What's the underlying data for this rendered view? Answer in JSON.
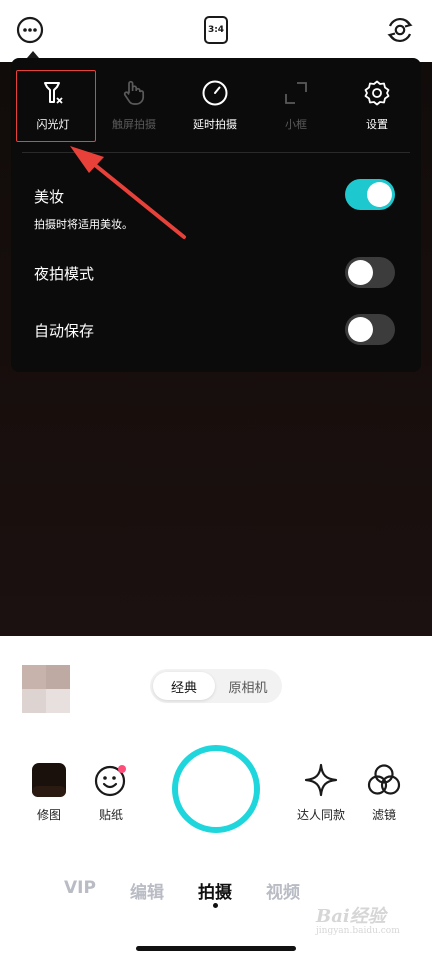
{
  "top_bar": {
    "more_icon": "more-dots-icon",
    "aspect_ratio_label": "3:4",
    "flip_icon": "camera-flip-icon"
  },
  "settings_panel": {
    "tools": [
      {
        "label": "闪光灯",
        "icon": "flash-off-icon",
        "enabled": true
      },
      {
        "label": "触屏拍摄",
        "icon": "touch-hand-icon",
        "enabled": false
      },
      {
        "label": "延时拍摄",
        "icon": "timer-icon",
        "enabled": true
      },
      {
        "label": "小框",
        "icon": "frame-corners-icon",
        "enabled": false
      },
      {
        "label": "设置",
        "icon": "gear-icon",
        "enabled": true
      }
    ],
    "beauty": {
      "label": "美妆",
      "description": "拍摄时将适用美妆。",
      "on": true
    },
    "night_mode": {
      "label": "夜拍模式",
      "on": false
    },
    "auto_save": {
      "label": "自动保存",
      "on": false
    }
  },
  "mode_switch": {
    "classic": "经典",
    "original": "原相机",
    "selected": "经典"
  },
  "bottom_tools": {
    "edit_label": "修图",
    "sticker_label": "贴纸",
    "influencer_label": "达人同款",
    "filter_label": "滤镜"
  },
  "tabs": [
    "VIP",
    "编辑",
    "拍摄",
    "视频"
  ],
  "active_tab": "拍摄",
  "watermark": {
    "main": "Bai经验",
    "sub": "jingyan.baidu.com"
  },
  "colors": {
    "accent": "#1ec8cf",
    "shutter": "#1fd6dc",
    "annotation": "#e8413a"
  }
}
